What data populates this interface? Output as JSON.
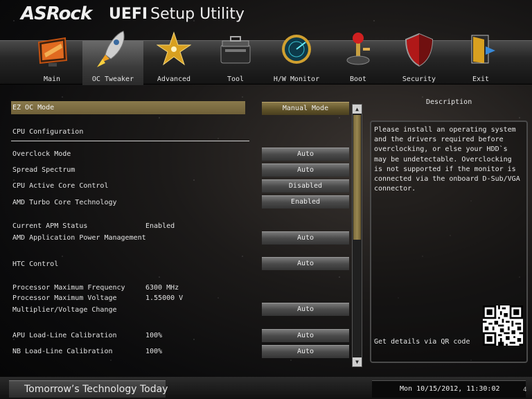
{
  "brand": {
    "name": "ASRock",
    "suffix_bold": "UEFI",
    "suffix_rest": "Setup Utility"
  },
  "nav": {
    "active": "OC Tweaker",
    "tabs": [
      {
        "label": "Main",
        "icon": "main-monitor-icon"
      },
      {
        "label": "OC Tweaker",
        "icon": "rocket-icon"
      },
      {
        "label": "Advanced",
        "icon": "star-icon"
      },
      {
        "label": "Tool",
        "icon": "toolbox-icon"
      },
      {
        "label": "H/W Monitor",
        "icon": "radar-icon"
      },
      {
        "label": "Boot",
        "icon": "joystick-icon"
      },
      {
        "label": "Security",
        "icon": "shield-icon"
      },
      {
        "label": "Exit",
        "icon": "exit-door-icon"
      }
    ]
  },
  "settings": {
    "ez_oc_mode": {
      "label": "EZ OC Mode",
      "value": "Manual Mode"
    },
    "cpu_config_heading": "CPU Configuration",
    "overclock_mode": {
      "label": "Overclock Mode",
      "value": "Auto"
    },
    "spread_spectrum": {
      "label": "Spread Spectrum",
      "value": "Auto"
    },
    "cpu_active_core": {
      "label": "CPU Active Core Control",
      "value": "Disabled"
    },
    "amd_turbo": {
      "label": "AMD Turbo Core Technology",
      "value": "Enabled"
    },
    "current_apm": {
      "label": "Current APM Status",
      "value": "Enabled"
    },
    "amd_apm": {
      "label": "AMD Application Power Management",
      "value": "Auto"
    },
    "htc": {
      "label": "HTC Control",
      "value": "Auto"
    },
    "proc_max_freq": {
      "label": "Processor Maximum Frequency",
      "value": "6300 MHz"
    },
    "proc_max_volt": {
      "label": "Processor Maximum Voltage",
      "value": "1.55000 V"
    },
    "mult_volt": {
      "label": "Multiplier/Voltage Change",
      "value": "Auto"
    },
    "apu_llc": {
      "label": "APU Load-Line Calibration",
      "info": "100%",
      "value": "Auto"
    },
    "nb_llc": {
      "label": "NB Load-Line Calibration",
      "info": "100%",
      "value": "Auto"
    }
  },
  "description": {
    "title": "Description",
    "text": "Please install an operating system and the drivers required before overclocking, or else your HDD`s may be undetectable. Overclocking is not supported if the monitor is connected via the onboard D-Sub/VGA connector.",
    "qr_label": "Get details via QR code"
  },
  "footer": {
    "slogan": "Tomorrow’s Technology Today",
    "datetime": "Mon 10/15/2012, 11:30:02",
    "corner": "4"
  },
  "colors": {
    "accent_gold": "#8a7a4c",
    "panel_border": "#4a4a4a"
  }
}
